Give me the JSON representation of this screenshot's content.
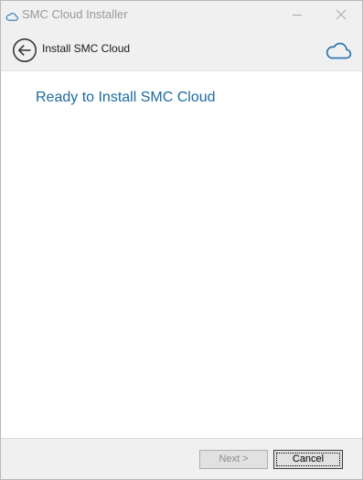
{
  "window": {
    "title": "SMC Cloud Installer",
    "title_icon": "cloud-icon",
    "controls": [
      "minimize-icon",
      "close-icon"
    ]
  },
  "header": {
    "title": "Install SMC Cloud",
    "back_icon": "back-arrow-icon",
    "brand_icon": "cloud-icon"
  },
  "main": {
    "heading": "Ready to Install SMC Cloud"
  },
  "footer": {
    "next_label": "Next >",
    "cancel_label": "Cancel"
  },
  "colors": {
    "accent": "#1c6ba3",
    "chrome_bg": "#f0f0f0",
    "content_bg": "#ffffff"
  }
}
